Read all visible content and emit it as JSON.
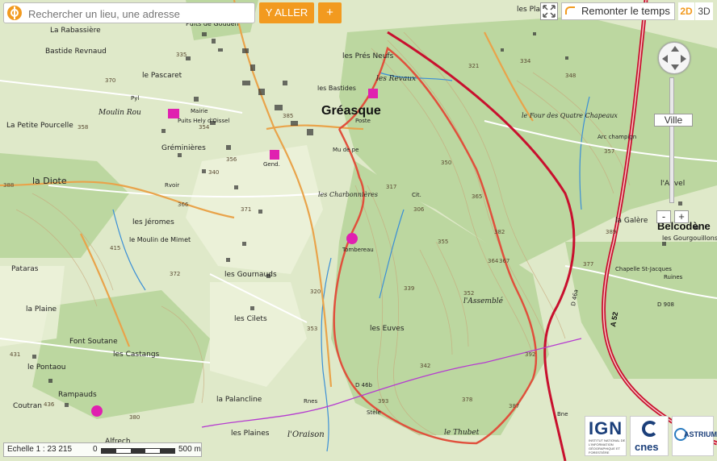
{
  "toolbar": {
    "search_placeholder": "Rechercher un lieu, une adresse",
    "go_label": "Y ALLER",
    "plus_label": "+",
    "time_label": "Remonter le temps",
    "view_2d": "2D",
    "view_3d": "3D"
  },
  "zoom": {
    "label": "Ville",
    "zoom_out": "-",
    "zoom_in": "+"
  },
  "scale": {
    "label": "Echelle 1 : 23 215",
    "zero": "0",
    "distance": "500 m"
  },
  "logos": {
    "ign": "IGN",
    "ign_sub": "INSTITUT NATIONAL DE L'INFORMATION GÉOGRAPHIQUE ET FORESTIÈRE",
    "cnes": "cnes",
    "astrium": "ASTRIUM"
  },
  "colors": {
    "accent": "#f29a1f",
    "route_main": "#c8102e",
    "route_trail": "#e0503c",
    "land": "#dfe9c9",
    "forest": "#bcd7a0",
    "river": "#3b8fd6"
  },
  "map": {
    "town_main": "Gréasque",
    "places": [
      "La Rabassière",
      "Bastide Revnaud",
      "le Pascaret",
      "Moulin Rou",
      "La Petite Pourcelle",
      "Gréminières",
      "la Diote",
      "les Jéromes",
      "le Moulin de Mimet",
      "Pataras",
      "la Plaine",
      "Font Soutane",
      "les Castangs",
      "le Pontaou",
      "Coutran",
      "Rampauds",
      "Alfrech",
      "la Palancline",
      "les Plaines",
      "l'Oraison",
      "les Gournauds",
      "les Cilets",
      "les Euves",
      "les Prés Neufs",
      "les Bastides",
      "les Revaux",
      "les Charbonnières",
      "Tombereau",
      "l'Assemblé",
      "le Thubet",
      "le Four des Quatre Chapeaux",
      "la Galère",
      "l'Auvel",
      "Chapelle St-Jacques",
      "les Gourgouillons",
      "Belcodène",
      "Puits de Gouden",
      "les Plan"
    ],
    "labels_misc": [
      "Mairie",
      "Poste",
      "Gend.",
      "Puits Hely d'Oissel",
      "Mu de pe",
      "Rvoir",
      "Cit.",
      "Ruines",
      "Rnes",
      "Stèle",
      "Bne",
      "Pyl",
      "Arc champign"
    ],
    "road_codes": [
      "A 52",
      "D 46a",
      "D 46b",
      "D 908"
    ],
    "elevations": [
      "335",
      "370",
      "358",
      "354",
      "356",
      "353",
      "340",
      "317",
      "321",
      "334",
      "348",
      "357",
      "364",
      "365",
      "378",
      "367",
      "392",
      "393",
      "387",
      "339",
      "342",
      "382",
      "352",
      "350",
      "306",
      "355",
      "389",
      "415",
      "372",
      "320",
      "388",
      "371",
      "431",
      "380",
      "436",
      "385",
      "366",
      "377"
    ]
  }
}
